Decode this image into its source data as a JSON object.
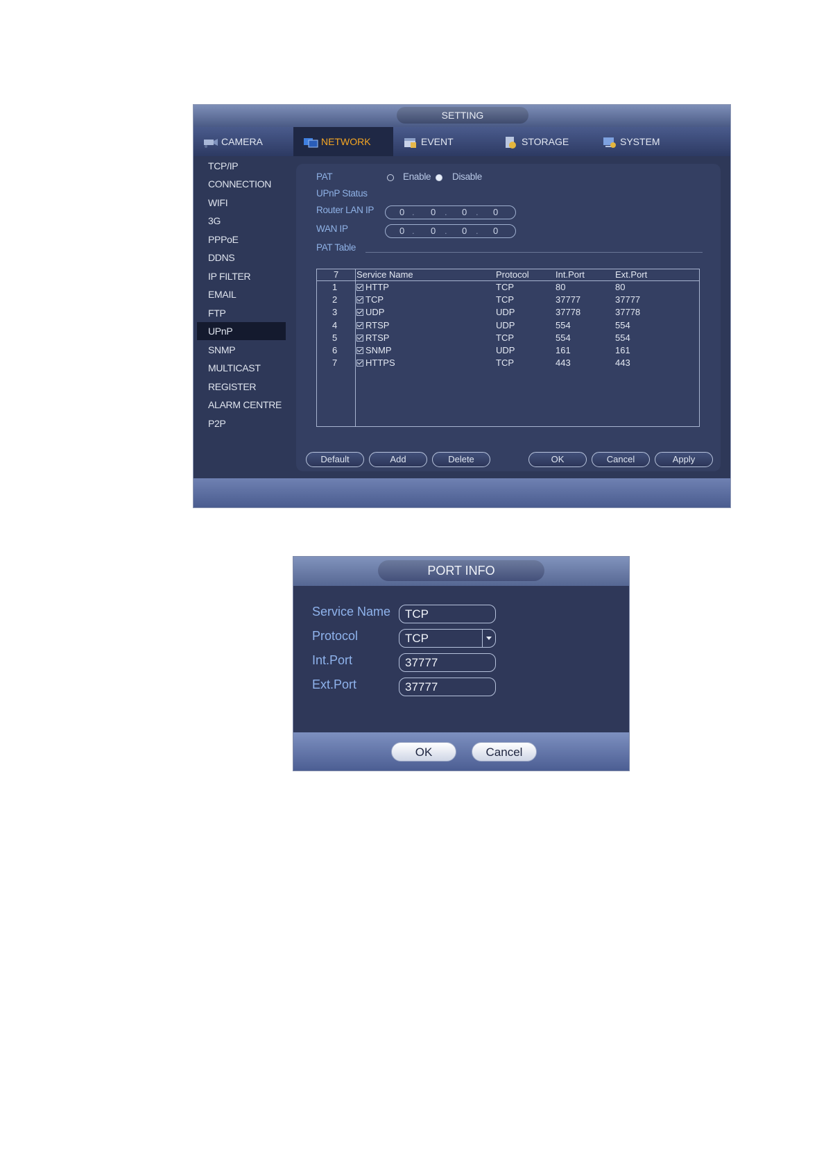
{
  "setting": {
    "title": "SETTING",
    "tabs": [
      {
        "label": "CAMERA",
        "icon": "camera-icon"
      },
      {
        "label": "NETWORK",
        "icon": "network-icon",
        "active": true
      },
      {
        "label": "EVENT",
        "icon": "event-icon"
      },
      {
        "label": "STORAGE",
        "icon": "storage-icon"
      },
      {
        "label": "SYSTEM",
        "icon": "system-icon"
      }
    ],
    "sidebar": {
      "items": [
        "TCP/IP",
        "CONNECTION",
        "WIFI",
        "3G",
        "PPPoE",
        "DDNS",
        "IP FILTER",
        "EMAIL",
        "FTP",
        "UPnP",
        "SNMP",
        "MULTICAST",
        "REGISTER",
        "ALARM CENTRE",
        "P2P"
      ],
      "active": "UPnP"
    },
    "content": {
      "pat_label": "PAT",
      "enable_label": "Enable",
      "disable_label": "Disable",
      "pat_selected": "Disable",
      "upnp_status_label": "UPnP Status",
      "router_lan_ip_label": "Router LAN IP",
      "router_lan_ip": [
        "0",
        "0",
        "0",
        "0"
      ],
      "wan_ip_label": "WAN IP",
      "wan_ip": [
        "0",
        "0",
        "0",
        "0"
      ],
      "pat_table_label": "PAT Table",
      "table": {
        "count": "7",
        "headers": [
          "Service Name",
          "Protocol",
          "Int.Port",
          "Ext.Port"
        ],
        "rows": [
          {
            "no": "1",
            "service": "HTTP",
            "protocol": "TCP",
            "int_port": "80",
            "ext_port": "80"
          },
          {
            "no": "2",
            "service": "TCP",
            "protocol": "TCP",
            "int_port": "37777",
            "ext_port": "37777"
          },
          {
            "no": "3",
            "service": "UDP",
            "protocol": "UDP",
            "int_port": "37778",
            "ext_port": "37778"
          },
          {
            "no": "4",
            "service": "RTSP",
            "protocol": "UDP",
            "int_port": "554",
            "ext_port": "554"
          },
          {
            "no": "5",
            "service": "RTSP",
            "protocol": "TCP",
            "int_port": "554",
            "ext_port": "554"
          },
          {
            "no": "6",
            "service": "SNMP",
            "protocol": "UDP",
            "int_port": "161",
            "ext_port": "161"
          },
          {
            "no": "7",
            "service": "HTTPS",
            "protocol": "TCP",
            "int_port": "443",
            "ext_port": "443"
          }
        ]
      },
      "buttons": {
        "default": "Default",
        "add": "Add",
        "delete": "Delete",
        "ok": "OK",
        "cancel": "Cancel",
        "apply": "Apply"
      }
    }
  },
  "port_info": {
    "title": "PORT INFO",
    "service_name_label": "Service Name",
    "service_name": "TCP",
    "protocol_label": "Protocol",
    "protocol": "TCP",
    "int_port_label": "Int.Port",
    "int_port": "37777",
    "ext_port_label": "Ext.Port",
    "ext_port": "37777",
    "ok_label": "OK",
    "cancel_label": "Cancel"
  }
}
